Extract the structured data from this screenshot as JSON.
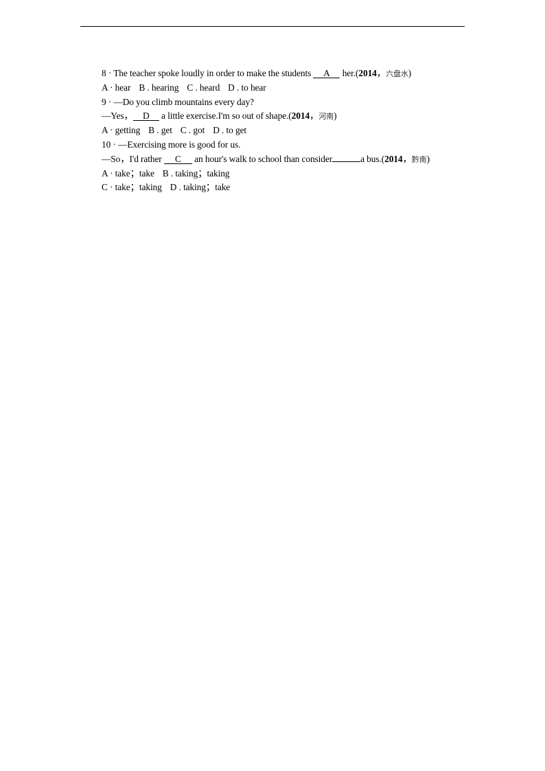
{
  "questions": [
    {
      "number": "8",
      "lines": {
        "stem_before": "8 · The teacher spoke loudly in order to make the students ",
        "answer": "A",
        "stem_after": " her.(",
        "year": "2014",
        "sep": "，",
        "region": "六盘水",
        "close": ")"
      },
      "options": [
        "A · hear",
        "B . hearing",
        "C . heard",
        "D . to hear"
      ]
    },
    {
      "number": "9",
      "line1": "9 · —Do you climb mountains every day?",
      "line2": {
        "before": "—Yes，",
        "answer": "D",
        "after": " a little exercise.I'm so out of shape.(",
        "year": "2014",
        "sep": "，",
        "region": "河南",
        "close": ")"
      },
      "options": [
        "A · getting",
        "B . get",
        "C . got",
        "D . to get"
      ]
    },
    {
      "number": "10",
      "line1": "10 · —Exercising more is good for us.",
      "line2": {
        "before": "—So，I'd rather ",
        "answer": "C",
        "middle": " an hour's walk to school than consider",
        "after": "a bus.(",
        "year": "2014",
        "sep": "，",
        "region": "黔南",
        "close": ")"
      },
      "options_row1": [
        "A · take；take",
        "B . taking；taking"
      ],
      "options_row2": [
        "C · take；taking",
        "D . taking；take"
      ]
    }
  ]
}
